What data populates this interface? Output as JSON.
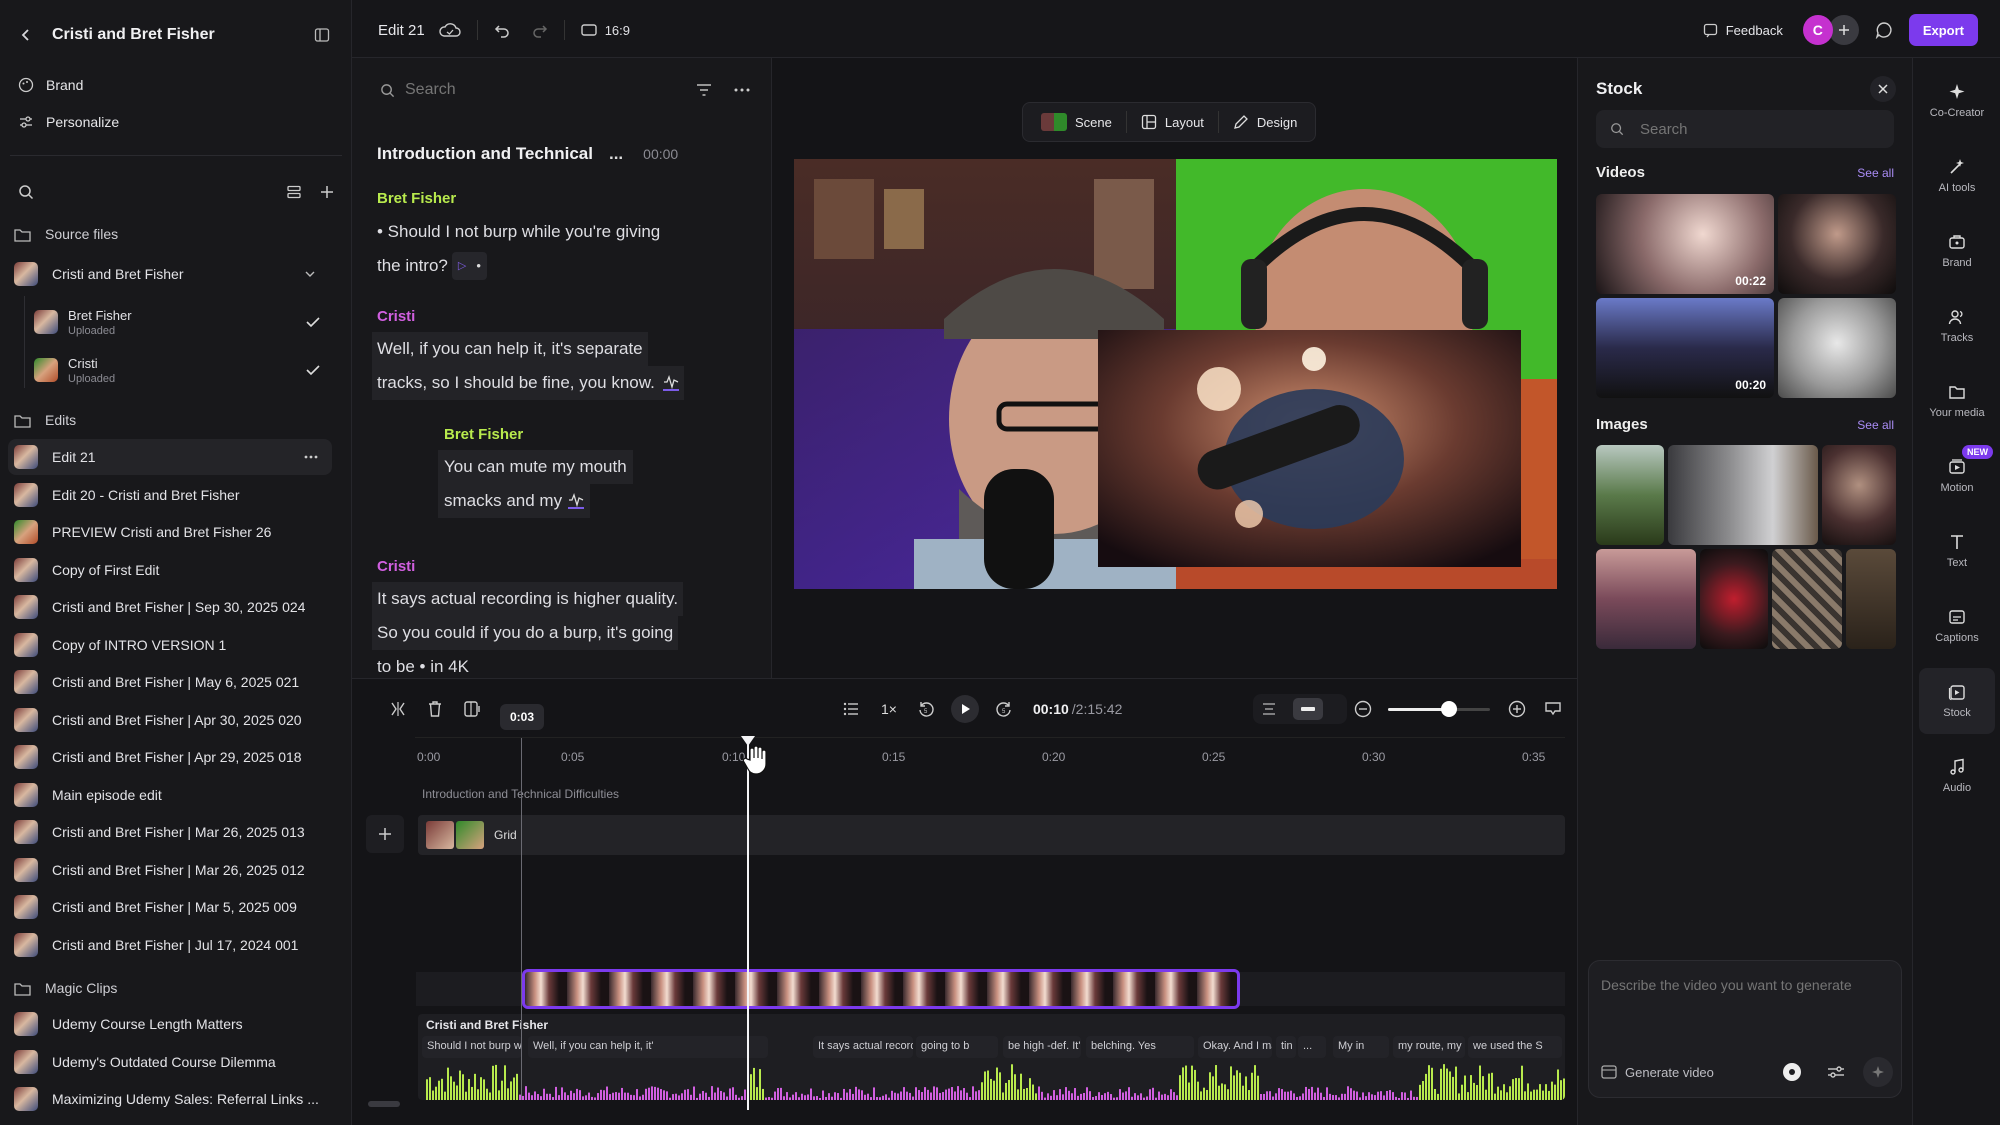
{
  "project": {
    "title": "Cristi and Bret Fisher"
  },
  "nav": {
    "brand": "Brand",
    "personalize": "Personalize"
  },
  "sections": {
    "source_files": "Source files",
    "edits": "Edits",
    "magic_clips": "Magic Clips"
  },
  "source_group": {
    "label": "Cristi and Bret Fisher"
  },
  "sources": [
    {
      "name": "Bret Fisher",
      "status": "Uploaded"
    },
    {
      "name": "Cristi",
      "status": "Uploaded"
    }
  ],
  "edits": [
    "Edit 21",
    "Edit 20 - Cristi and Bret Fisher",
    "PREVIEW Cristi and Bret Fisher 26",
    "Copy of First Edit",
    "Cristi and Bret Fisher | Sep 30, 2025 024",
    "Copy of INTRO VERSION 1",
    "Cristi and Bret Fisher | May 6, 2025 021",
    "Cristi and Bret Fisher | Apr 30, 2025 020",
    "Cristi and Bret Fisher | Apr 29, 2025 018",
    "Main episode edit",
    "Cristi and Bret Fisher | Mar 26, 2025 013",
    "Cristi and Bret Fisher | Mar 26, 2025 012",
    "Cristi and Bret Fisher | Mar 5, 2025 009",
    "Cristi and Bret Fisher | Jul 17, 2024 001"
  ],
  "magic_clips": [
    "Udemy Course Length Matters",
    "Udemy's Outdated Course Dilemma",
    "Maximizing Udemy Sales: Referral Links ..."
  ],
  "topbar": {
    "edit_name": "Edit 21",
    "aspect": "16:9",
    "feedback": "Feedback",
    "avatar": "C",
    "export": "Export"
  },
  "transcript": {
    "search_placeholder": "Search",
    "chapter_title": "Introduction and Technical",
    "chapter_more": "...",
    "chapter_time": "00:00",
    "blocks": [
      {
        "speaker": "Bret Fisher",
        "line1": "• Should I not burp while you're giving",
        "line2": "the intro?"
      },
      {
        "speaker": "Cristi",
        "line1": "Well, if you can help it, it's separate",
        "line2": "tracks, so I should be fine, you know."
      },
      {
        "speaker": "Bret Fisher",
        "line1": "You can mute my mouth",
        "line2": "smacks and my"
      },
      {
        "speaker": "Cristi",
        "line1": "It says actual recording is higher quality.",
        "line2": "So you could if you do a burp, it's going",
        "line3": "to be • in 4K"
      }
    ]
  },
  "preview_toolbar": {
    "scene": "Scene",
    "layout": "Layout",
    "design": "Design"
  },
  "stock": {
    "title": "Stock",
    "search_placeholder": "Search",
    "videos_label": "Videos",
    "images_label": "Images",
    "see_all": "See all",
    "video_durations": [
      "00:22",
      "00:20"
    ],
    "generate_placeholder": "Describe the video you want to generate",
    "generate_button": "Generate video"
  },
  "rail": [
    {
      "label": "Co-Creator",
      "icon": "sparkle-icon"
    },
    {
      "label": "AI tools",
      "icon": "wand-icon"
    },
    {
      "label": "Brand",
      "icon": "briefcase-icon"
    },
    {
      "label": "Tracks",
      "icon": "people-icon"
    },
    {
      "label": "Your media",
      "icon": "folder-icon"
    },
    {
      "label": "Motion",
      "icon": "motion-icon",
      "badge": "NEW"
    },
    {
      "label": "Text",
      "icon": "text-icon"
    },
    {
      "label": "Captions",
      "icon": "captions-icon"
    },
    {
      "label": "Stock",
      "icon": "stock-icon"
    },
    {
      "label": "Audio",
      "icon": "music-icon"
    }
  ],
  "timeline": {
    "speed": "1×",
    "current_time": "00:10",
    "total_time": "/2:15:42",
    "hover_time": "0:03",
    "ticks": [
      "0:00",
      "0:05",
      "0:10",
      "0:15",
      "0:20",
      "0:25",
      "0:30",
      "0:35"
    ],
    "chapter_label": "Introduction and Technical Difficulties",
    "layout_label": "Grid",
    "audio_track_label": "Cristi and Bret Fisher",
    "audio_words": [
      "Should I not burp whil",
      "Well, if you can help it, it'",
      "It says actual recording is h",
      "going to b",
      "be high -def. It'",
      "belching. Yes",
      "Okay. And I may fr",
      "tin",
      "...",
      "My in",
      "my route, my route",
      "we used the S"
    ],
    "zoom_level": 0.6
  },
  "colors": {
    "accent": "#7c3aed",
    "bret": "#b8ea4d",
    "cristi": "#d15fe0"
  }
}
